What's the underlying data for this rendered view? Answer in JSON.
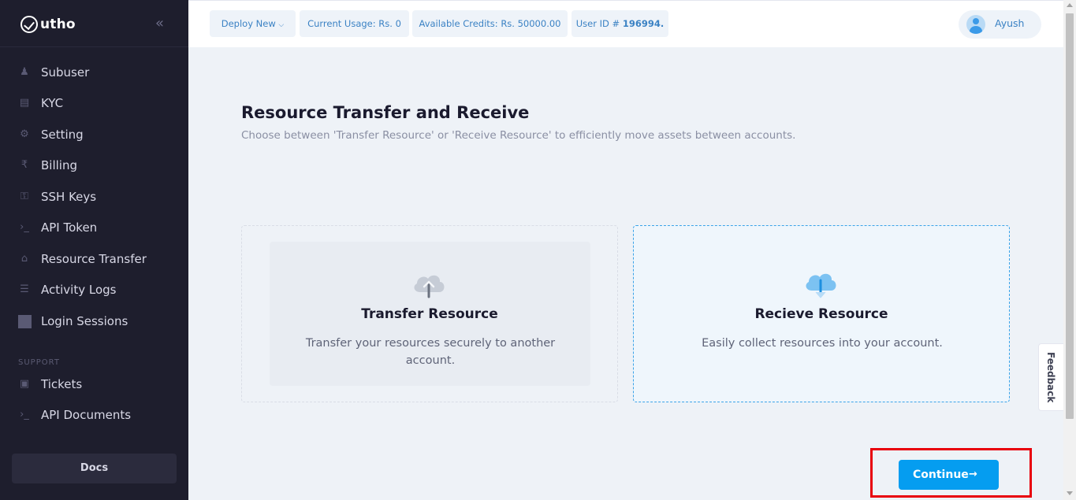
{
  "brand": {
    "name": "utho"
  },
  "sidebar": {
    "items": [
      {
        "label": "Subuser",
        "icon": "subuser-icon"
      },
      {
        "label": "KYC",
        "icon": "kyc-icon"
      },
      {
        "label": "Setting",
        "icon": "gear-icon"
      },
      {
        "label": "Billing",
        "icon": "rupee-icon"
      },
      {
        "label": "SSH Keys",
        "icon": "key-icon"
      },
      {
        "label": "API Token",
        "icon": "terminal-icon"
      },
      {
        "label": "Resource Transfer",
        "icon": "transfer-icon"
      },
      {
        "label": "Activity Logs",
        "icon": "sliders-icon"
      },
      {
        "label": "Login Sessions",
        "icon": "session-icon"
      }
    ],
    "support_label": "SUPPORT",
    "support_items": [
      {
        "label": "Tickets",
        "icon": "ticket-icon"
      },
      {
        "label": "API Documents",
        "icon": "terminal-icon"
      }
    ],
    "docs_label": "Docs"
  },
  "topbar": {
    "deploy_label": "Deploy New",
    "usage_label": "Current Usage: Rs. 0",
    "credits_label": "Available Credits: Rs. 50000.00",
    "userid_prefix": "User ID # ",
    "userid_value": "196994.",
    "user_name": "Ayush"
  },
  "main": {
    "title": "Resource Transfer and Receive",
    "subtitle": "Choose between 'Transfer Resource' or 'Receive Resource' to efficiently move assets between accounts.",
    "options": [
      {
        "title": "Transfer Resource",
        "description": "Transfer your resources securely to another account.",
        "icon": "cloud-upload-icon",
        "selected": false
      },
      {
        "title": "Recieve Resource",
        "description": "Easily collect resources into your account.",
        "icon": "cloud-download-icon",
        "selected": true
      }
    ],
    "continue_label": "Continue"
  },
  "feedback_label": "Feedback",
  "colors": {
    "accent": "#059df0",
    "sidebar_bg": "#1e1e2d",
    "highlight": "#e8000b"
  }
}
